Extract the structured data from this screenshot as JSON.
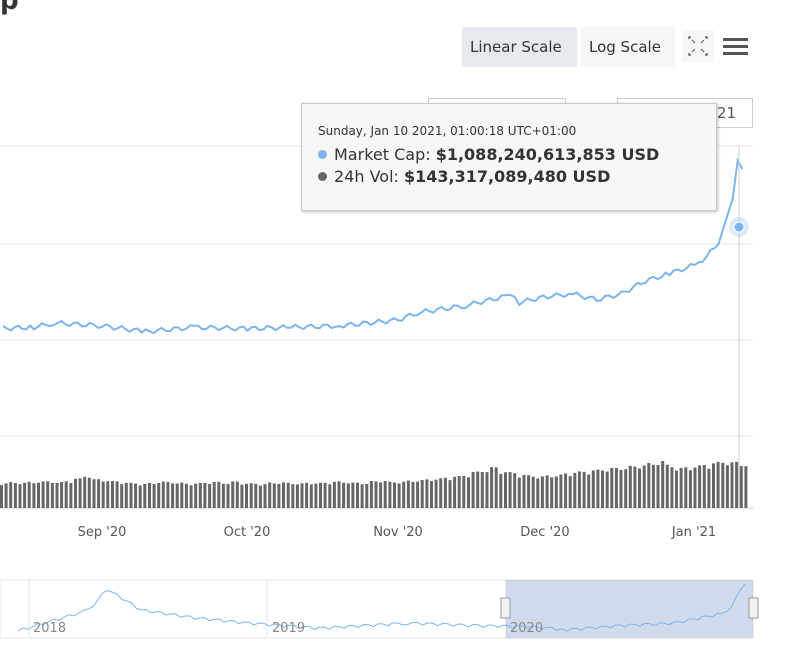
{
  "header": {
    "title_fragment": "p"
  },
  "toolbar": {
    "linear_label": "Linear Scale",
    "log_label": "Log Scale",
    "fullscreen_icon": "fullscreen-icon",
    "menu_icon": "hamburger-menu-icon"
  },
  "range_inputs": {
    "from_value": "",
    "to_value": "21"
  },
  "tooltip": {
    "date": "Sunday, Jan 10 2021, 01:00:18 UTC+01:00",
    "market_cap_label": "Market Cap:",
    "market_cap_value": "$1,088,240,613,853 USD",
    "volume_label": "24h Vol:",
    "volume_value": "$143,317,089,480 USD",
    "market_cap_color": "#7cb5ec",
    "volume_color": "#666666"
  },
  "chart_data": {
    "type": "line",
    "series": [
      {
        "name": "Market Cap",
        "color": "#7cb5ec",
        "x": [
          "2020-08-01",
          "2020-08-10",
          "2020-08-18",
          "2020-08-22",
          "2020-09-01",
          "2020-09-10",
          "2020-09-20",
          "2020-10-01",
          "2020-10-10",
          "2020-10-20",
          "2020-11-01",
          "2020-11-05",
          "2020-11-15",
          "2020-11-24",
          "2020-11-26",
          "2020-12-01",
          "2020-12-07",
          "2020-12-12",
          "2020-12-17",
          "2020-12-22",
          "2020-12-27",
          "2021-01-02",
          "2021-01-06",
          "2021-01-09",
          "2021-01-10",
          "2021-01-11"
        ],
        "values": [
          0.365,
          0.37,
          0.375,
          0.39,
          0.38,
          0.36,
          0.375,
          0.37,
          0.375,
          0.38,
          0.4,
          0.425,
          0.45,
          0.485,
          0.46,
          0.48,
          0.49,
          0.47,
          0.49,
          0.535,
          0.56,
          0.595,
          0.66,
          0.82,
          0.95,
          0.92
        ]
      },
      {
        "name": "24h Vol",
        "type": "bar",
        "color": "#666666",
        "values": [
          0.4,
          0.42,
          0.41,
          0.43,
          0.44,
          0.45,
          0.42,
          0.46,
          0.52,
          0.6,
          0.5,
          0.48,
          0.45,
          0.42,
          0.4,
          0.38,
          0.4,
          0.44,
          0.43,
          0.41,
          0.39,
          0.4,
          0.42,
          0.43,
          0.41,
          0.44,
          0.4,
          0.39,
          0.38,
          0.41,
          0.42,
          0.4,
          0.39,
          0.41,
          0.4,
          0.42,
          0.44,
          0.43,
          0.41,
          0.4,
          0.45,
          0.47,
          0.43,
          0.44,
          0.46,
          0.48,
          0.5,
          0.52,
          0.55,
          0.58,
          0.62,
          0.7,
          0.75,
          0.82,
          0.72,
          0.68,
          0.63,
          0.6,
          0.58,
          0.6,
          0.62,
          0.66,
          0.7,
          0.72,
          0.75,
          0.78,
          0.8,
          0.82,
          0.85,
          0.9,
          0.92,
          1.0,
          0.88,
          0.8,
          0.82,
          0.86,
          0.9,
          0.95,
          0.98,
          0.96,
          0.92
        ]
      }
    ],
    "x_tick_labels": [
      "Sep '20",
      "Oct '20",
      "Nov '20",
      "Dec '20",
      "Jan '21"
    ],
    "navigator": {
      "labels": [
        "2018",
        "2019",
        "2020"
      ],
      "x": [
        "2017-08",
        "2017-12",
        "2018-01",
        "2018-03",
        "2018-06",
        "2018-09",
        "2019-01",
        "2019-06",
        "2019-10",
        "2020-01",
        "2020-03",
        "2020-06",
        "2020-09",
        "2020-12",
        "2021-01"
      ],
      "values": [
        0.1,
        0.5,
        0.9,
        0.5,
        0.35,
        0.25,
        0.15,
        0.25,
        0.2,
        0.18,
        0.12,
        0.2,
        0.25,
        0.45,
        1.0
      ]
    },
    "grid": true
  }
}
